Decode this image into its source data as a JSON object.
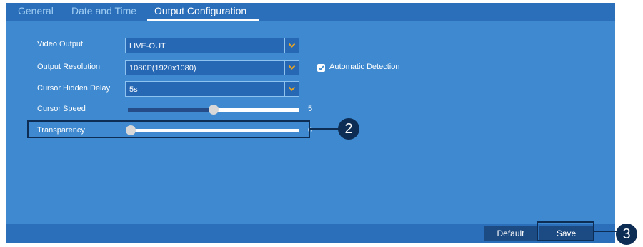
{
  "tabs": [
    {
      "label": "General",
      "active": false
    },
    {
      "label": "Date and Time",
      "active": false
    },
    {
      "label": "Output Configuration",
      "active": true
    }
  ],
  "fields": {
    "video_output": {
      "label": "Video Output",
      "value": "LIVE-OUT"
    },
    "output_resolution": {
      "label": "Output Resolution",
      "value": "1080P(1920x1080)"
    },
    "cursor_hidden_delay": {
      "label": "Cursor Hidden Delay",
      "value": "5s"
    },
    "cursor_speed": {
      "label": "Cursor Speed",
      "value": "5",
      "level_fraction": 0.5
    },
    "transparency": {
      "label": "Transparency",
      "value": "0",
      "level_fraction": 0.0
    }
  },
  "automatic_detection": {
    "label": "Automatic Detection",
    "checked": true
  },
  "callouts": {
    "transparency": "2",
    "save": "3"
  },
  "footer": {
    "default_label": "Default",
    "save_label": "Save"
  },
  "colors": {
    "panel": "#3e89cf",
    "bar": "#2b6fba",
    "dropdown_accent": "#e8a524",
    "callout": "#0d2d55"
  }
}
